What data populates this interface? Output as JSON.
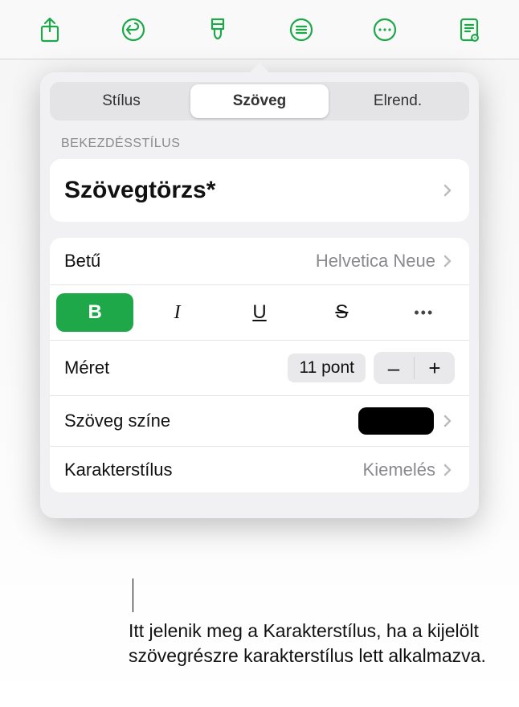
{
  "toolbar": {
    "icons": [
      "share-icon",
      "undo-icon",
      "brush-icon",
      "list-icon",
      "more-icon",
      "reader-icon"
    ]
  },
  "tabs": {
    "style": "Stílus",
    "text": "Szöveg",
    "arrange": "Elrend."
  },
  "sectionLabel": "BEKEZDÉSSTÍLUS",
  "paragraphStyle": "Szövegtörzs*",
  "font": {
    "label": "Betű",
    "value": "Helvetica Neue"
  },
  "format": {
    "bold": "B",
    "italic": "I",
    "underline": "U",
    "strike": "S",
    "more": "•••"
  },
  "size": {
    "label": "Méret",
    "value": "11 pont",
    "minus": "–",
    "plus": "+"
  },
  "textColor": {
    "label": "Szöveg színe",
    "color": "#000000"
  },
  "characterStyle": {
    "label": "Karakterstílus",
    "value": "Kiemelés"
  },
  "callout": "Itt jelenik meg a Karakterstílus, ha a kijelölt szövegrészre karakterstílus lett alkalmazva."
}
